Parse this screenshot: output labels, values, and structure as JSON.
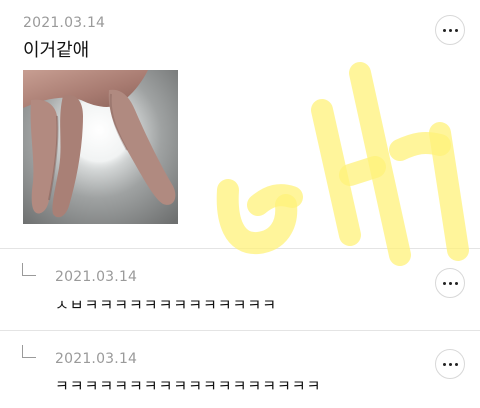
{
  "post": {
    "date": "2021.03.14",
    "text": "이거같애",
    "more_label": "more options"
  },
  "replies": [
    {
      "date": "2021.03.14",
      "text": "ㅅㅂㅋㅋㅋㅋㅋㅋㅋㅋㅋㅋㅋㅋㅋ"
    },
    {
      "date": "2021.03.14",
      "text": "ㅋㅋㅋㅋㅋㅋㅋㅋㅋㅋㅋㅋㅋㅋㅋㅋㅋㅋ"
    }
  ],
  "colors": {
    "watermark": "#fff27a",
    "divider": "#e4e4e4",
    "date": "#9a9a9a"
  }
}
